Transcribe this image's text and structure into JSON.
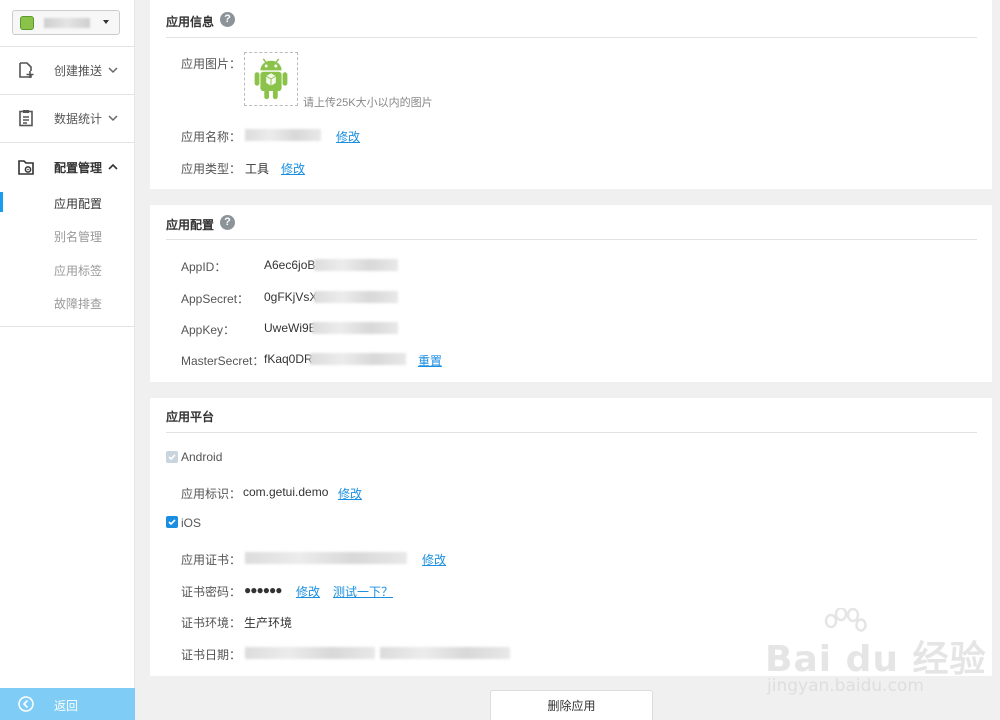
{
  "sidebar": {
    "nav": [
      {
        "label": "创建推送",
        "icon": "add-doc-icon"
      },
      {
        "label": "数据统计",
        "icon": "clipboard-icon"
      },
      {
        "label": "配置管理",
        "icon": "folder-gear-icon"
      }
    ],
    "sub_items": [
      "应用配置",
      "别名管理",
      "应用标签",
      "故障排查"
    ],
    "back_label": "返回"
  },
  "app_info": {
    "title": "应用信息",
    "help": "?",
    "image_label": "应用图片：",
    "image_hint": "请上传25K大小以内的图片",
    "name_label": "应用名称：",
    "name_edit": "修改",
    "type_label": "应用类型：",
    "type_value": "工具",
    "type_edit": "修改"
  },
  "app_config": {
    "title": "应用配置",
    "help": "?",
    "rows": [
      {
        "label": "AppID：",
        "value": "A6ec6joB"
      },
      {
        "label": "AppSecret：",
        "value": "0gFKjVsX"
      },
      {
        "label": "AppKey：",
        "value": "UweWi9E"
      },
      {
        "label": "MasterSecret：",
        "value": "fKaq0DR"
      }
    ],
    "reset_label": "重置"
  },
  "app_platform": {
    "title": "应用平台",
    "android_label": "Android",
    "android_pkg_label": "应用标识：",
    "android_pkg_value": "com.getui.demo",
    "android_pkg_edit": "修改",
    "ios_label": "iOS",
    "cert_label": "应用证书：",
    "cert_edit": "修改",
    "pwd_label": "证书密码：",
    "pwd_value": "●●●●●●",
    "pwd_edit": "修改",
    "pwd_test": "测试一下？",
    "env_label": "证书环境：",
    "env_value": "生产环境",
    "date_label": "证书日期："
  },
  "delete_label": "删除应用",
  "watermark": {
    "main": "Bai du 经验",
    "sub": "jingyan.baidu.com"
  },
  "colors": {
    "accent": "#1a8ee0",
    "back_bar": "#7fcdf6",
    "android_green": "#8bc34a"
  }
}
